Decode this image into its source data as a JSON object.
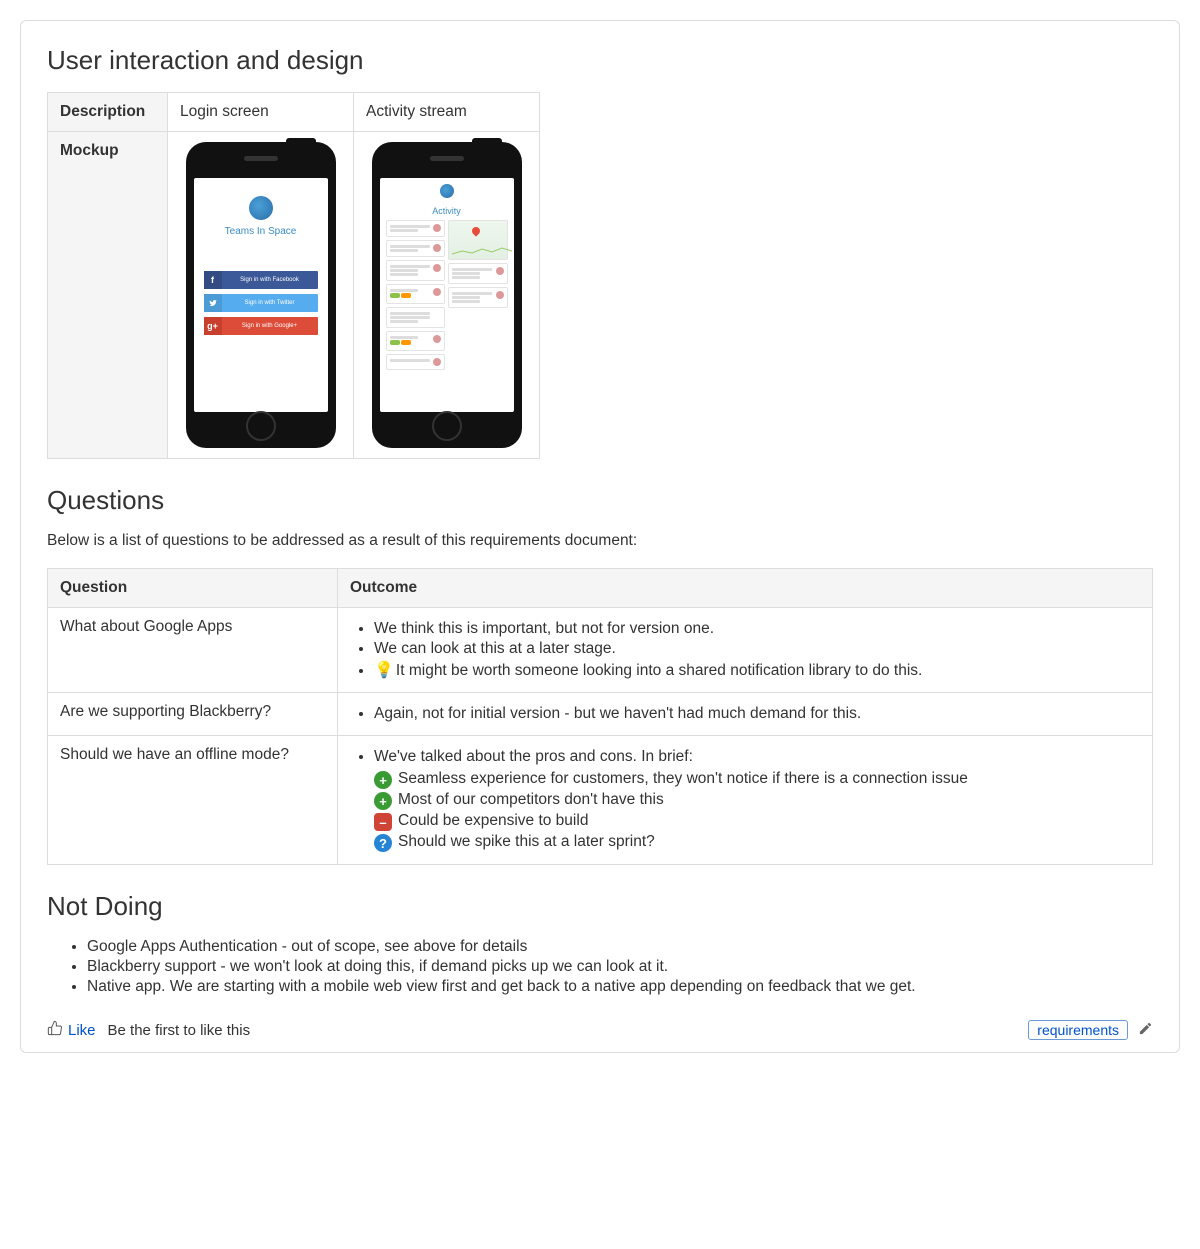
{
  "sections": {
    "design_heading": "User interaction and design",
    "questions_heading": "Questions",
    "notdoing_heading": "Not Doing"
  },
  "design_table": {
    "row_header_description": "Description",
    "row_header_mockup": "Mockup",
    "col1": "Login screen",
    "col2": "Activity stream",
    "login_brand": "Teams In Space",
    "login_buttons": {
      "facebook": "Sign in with Facebook",
      "twitter": "Sign in with Twitter",
      "google": "Sign in with Google+"
    },
    "activity_title": "Activity"
  },
  "questions_intro": "Below is a list of questions to be addressed as a result of this requirements document:",
  "questions_table": {
    "header_question": "Question",
    "header_outcome": "Outcome",
    "rows": [
      {
        "question": "What about Google Apps",
        "bullets": [
          "We think this is important, but not for version one.",
          "We can look at this at a later stage.",
          "It might be worth someone looking into a shared notification library to do this."
        ]
      },
      {
        "question": "Are we supporting Blackberry?",
        "bullets": [
          "Again, not for initial version - but we haven't had much demand for this."
        ]
      },
      {
        "question": "Should we have an offline mode?",
        "bullets": [
          "We've talked about the pros and cons. In brief:"
        ],
        "sub": [
          {
            "icon": "plus",
            "text": "Seamless experience for customers, they won't notice if there is a connection issue"
          },
          {
            "icon": "plus",
            "text": "Most of our competitors don't have this"
          },
          {
            "icon": "minus",
            "text": "Could be expensive to build"
          },
          {
            "icon": "question",
            "text": "Should we spike this at a later sprint?"
          }
        ]
      }
    ]
  },
  "not_doing": [
    "Google Apps Authentication - out of scope, see above for details",
    "Blackberry support - we won't look at doing this, if demand picks up we can look at it.",
    "Native app. We are starting with a mobile web view first and get back to a native app depending on feedback that we get."
  ],
  "footer": {
    "like": "Like",
    "like_prompt": "Be the first to like this",
    "tag": "requirements"
  }
}
